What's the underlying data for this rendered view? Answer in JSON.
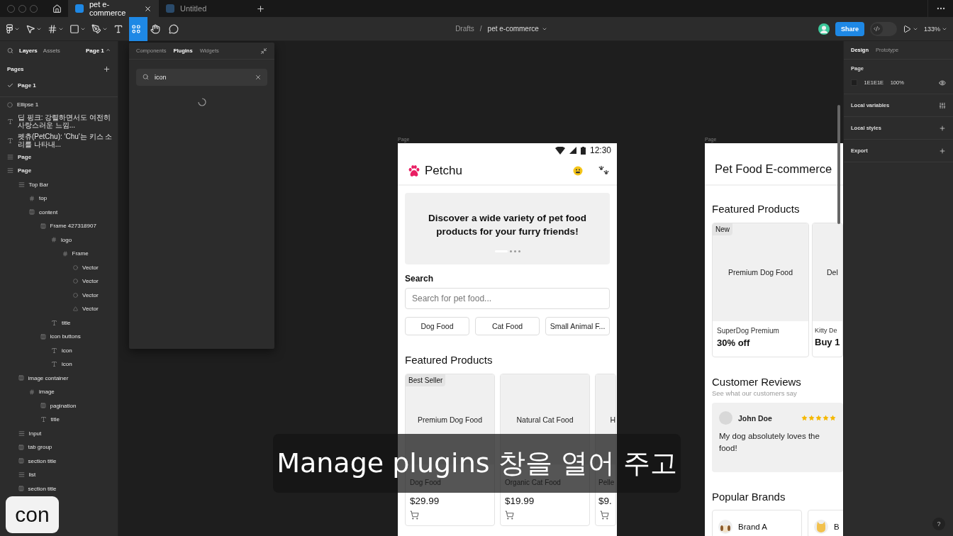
{
  "tabs": [
    {
      "kind": "home",
      "selected": false
    },
    {
      "kind": "file",
      "label": "pet e-commerce",
      "selected": true
    },
    {
      "kind": "file",
      "label": "Untitled",
      "selected": false
    }
  ],
  "tools": [
    {
      "kind": "menu",
      "selected": false
    },
    {
      "kind": "move",
      "selected": false
    },
    {
      "kind": "frame",
      "selected": false
    },
    {
      "kind": "shape",
      "selected": false
    },
    {
      "kind": "pen",
      "selected": false
    },
    {
      "kind": "text",
      "selected": false
    },
    {
      "kind": "actions",
      "selected": true
    },
    {
      "kind": "hand",
      "selected": false
    },
    {
      "kind": "comment",
      "selected": false
    }
  ],
  "breadcrumb": {
    "folder": "Drafts",
    "separator": "/",
    "file": "pet e-commerce"
  },
  "toolbar_right": {
    "share": "Share",
    "dev_mode": {
      "on": false
    },
    "zoom": "133%"
  },
  "left_panel": {
    "tabs": [
      {
        "label": "Layers",
        "selected": true
      },
      {
        "label": "Assets",
        "selected": false
      }
    ],
    "page_menu": "Page 1",
    "pages_title": "Pages",
    "pages": [
      {
        "label": "Page 1",
        "selected": true
      }
    ],
    "layers": [
      {
        "kind": "ellipse",
        "name": "Ellipse 1"
      },
      {
        "kind": "text",
        "name": "딥 핑크: 강렬하면서도 여전히 사랑스러운 느낌..."
      },
      {
        "kind": "text",
        "name": "펫츄(PetChu): 'Chu'는 키스 소리를 나타내..."
      },
      {
        "kind": "stack",
        "name": "Page"
      },
      {
        "kind": "stack",
        "name": "Page",
        "children": [
          {
            "kind": "stack",
            "name": "Top Bar",
            "children": [
              {
                "kind": "frame",
                "name": "top"
              },
              {
                "kind": "autolayout",
                "name": "content",
                "children": [
                  {
                    "kind": "autolayout",
                    "name": "Frame 427318907",
                    "children": [
                      {
                        "kind": "frame",
                        "name": "logo",
                        "children": [
                          {
                            "kind": "frame",
                            "name": "Frame",
                            "children": [
                              {
                                "kind": "vector",
                                "name": "Vector"
                              },
                              {
                                "kind": "vector",
                                "name": "Vector"
                              },
                              {
                                "kind": "vector",
                                "name": "Vector"
                              },
                              {
                                "kind": "shape",
                                "name": "Vector"
                              }
                            ]
                          }
                        ]
                      },
                      {
                        "kind": "text",
                        "name": "title"
                      }
                    ]
                  },
                  {
                    "kind": "autolayout",
                    "name": "icon buttons",
                    "children": [
                      {
                        "kind": "text",
                        "name": "icon"
                      },
                      {
                        "kind": "text",
                        "name": "icon"
                      }
                    ]
                  }
                ]
              }
            ]
          },
          {
            "kind": "autolayout",
            "name": "image container",
            "children": [
              {
                "kind": "frame",
                "name": "image",
                "children": [
                  {
                    "kind": "autolayout",
                    "name": "pagination"
                  },
                  {
                    "kind": "text",
                    "name": "title"
                  }
                ]
              }
            ]
          },
          {
            "kind": "stack",
            "name": "Input"
          },
          {
            "kind": "autolayout",
            "name": "tab group"
          },
          {
            "kind": "autolayout",
            "name": "section title"
          },
          {
            "kind": "stack",
            "name": "list"
          },
          {
            "kind": "autolayout",
            "name": "section title"
          }
        ]
      }
    ]
  },
  "plugins_panel": {
    "tabs": [
      {
        "label": "Components",
        "selected": false
      },
      {
        "label": "Plugins",
        "selected": true
      },
      {
        "label": "Widgets",
        "selected": false
      }
    ],
    "search": {
      "value": "icon"
    },
    "loading": true
  },
  "frame_labels": [
    "Page",
    "Page"
  ],
  "phone": {
    "status_time": "12:30",
    "app_title": "Petchu",
    "banner": "Discover a wide variety of pet food products for your furry friends!",
    "pagination": [
      {
        "selected": true
      },
      {
        "selected": false
      },
      {
        "selected": false
      },
      {
        "selected": false
      }
    ],
    "search_label": "Search",
    "search": {
      "placeholder": "Search for pet food..."
    },
    "chips": [
      "Dog Food",
      "Cat Food",
      "Small Animal F..."
    ],
    "section_title": "Featured Products",
    "products": [
      {
        "badge": "Best Seller",
        "image_label": "Premium Dog Food",
        "name": "Dog Food",
        "price": "$29.99"
      },
      {
        "image_label": "Natural Cat Food",
        "name": "Organic Cat Food",
        "price": "$19.99"
      },
      {
        "image_label": "H",
        "name": "Pelle",
        "price": "$9."
      }
    ]
  },
  "web": {
    "title": "Pet Food E-commerce",
    "featured_title": "Featured Products",
    "products": [
      {
        "badge": "New",
        "image_label": "Premium Dog Food",
        "name": "SuperDog Premium",
        "offer": "30% off"
      },
      {
        "image_label": "Del",
        "name": "Kitty De",
        "offer": "Buy 1"
      }
    ],
    "reviews_title": "Customer Reviews",
    "reviews_subtitle": "See what our customers say",
    "review": {
      "name": "John Doe",
      "stars": 5,
      "text": "My dog absolutely loves the food!"
    },
    "brands_title": "Popular Brands",
    "brands": [
      {
        "kind": "dog",
        "name": "Brand A"
      },
      {
        "kind": "cat",
        "name": "B"
      }
    ]
  },
  "right_panel": {
    "tabs": [
      {
        "label": "Design",
        "selected": true
      },
      {
        "label": "Prototype",
        "selected": false
      }
    ],
    "page_title": "Page",
    "page_color": "1E1E1E",
    "page_opacity": "100%",
    "sections": [
      "Local variables",
      "Local styles",
      "Export"
    ]
  },
  "help": "?",
  "subtitle": "Manage plugins 창을 열어 주고",
  "key_overlay": "con"
}
